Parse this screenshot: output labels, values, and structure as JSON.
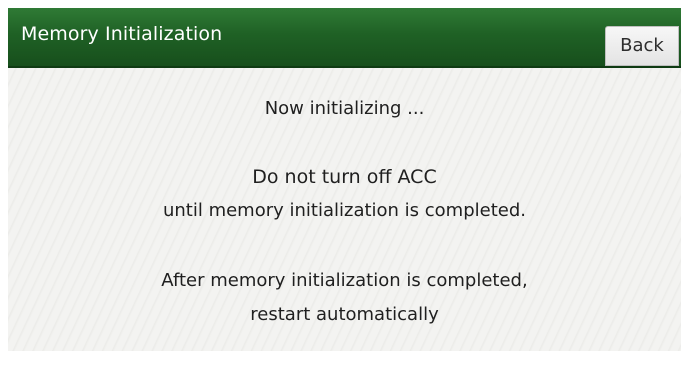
{
  "header": {
    "title": "Memory Initialization",
    "back_label": "Back"
  },
  "message": {
    "status": "Now initializing ...",
    "warning_line1": "Do not turn off ACC",
    "warning_line2": "until memory initialization is completed.",
    "info_line1": "After memory initialization is completed,",
    "info_line2": "restart automatically"
  },
  "colors": {
    "header_green": "#1f6125",
    "text": "#1f1f1f",
    "background": "#f2f2f0"
  }
}
